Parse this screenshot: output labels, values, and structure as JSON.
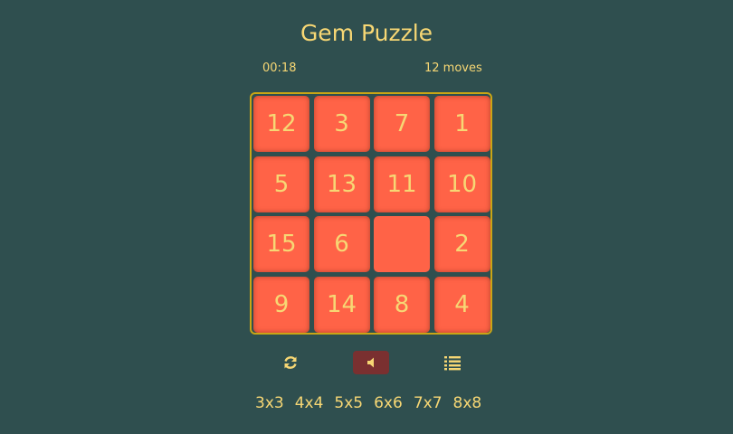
{
  "title": "Gem Puzzle",
  "time": "00:18",
  "moves": "12 moves",
  "board": {
    "size": 4,
    "tiles": [
      [
        "12",
        "3",
        "7",
        "1"
      ],
      [
        "5",
        "13",
        "11",
        "10"
      ],
      [
        "15",
        "6",
        "",
        "2"
      ],
      [
        "9",
        "14",
        "8",
        "4"
      ]
    ]
  },
  "controls": {
    "refresh_icon": "refresh-icon",
    "sound_icon": "volume-icon",
    "list_icon": "list-icon"
  },
  "sizes": [
    "3x3",
    "4x4",
    "5x5",
    "6x6",
    "7x7",
    "8x8"
  ],
  "colors": {
    "background": "#2f4f4f",
    "tile": "#ff6347",
    "text": "#f7d774",
    "border": "#c9a515",
    "sound_button": "#7a3030"
  }
}
